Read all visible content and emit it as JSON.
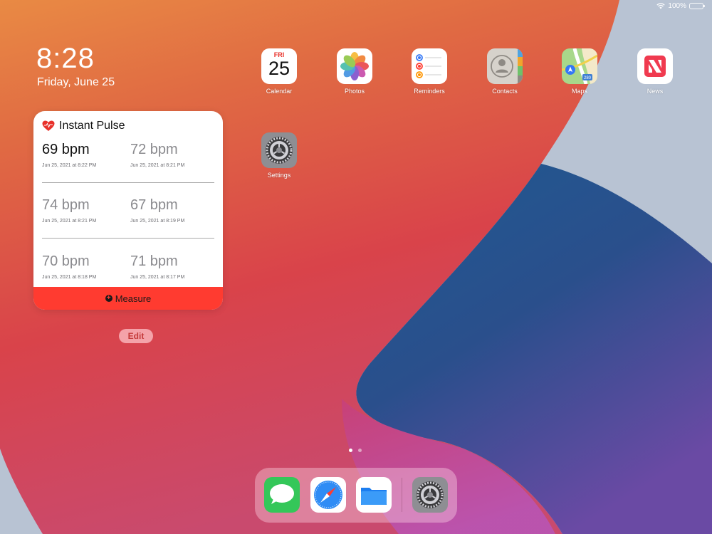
{
  "status": {
    "battery": "100%"
  },
  "lockscreen": {
    "time": "8:28",
    "date": "Friday, June 25"
  },
  "widget": {
    "title": "Instant Pulse",
    "readings": [
      {
        "bpm": "69 bpm",
        "time": "Jun 25, 2021 at 8:22 PM"
      },
      {
        "bpm": "72 bpm",
        "time": "Jun 25, 2021 at 8:21 PM"
      },
      {
        "bpm": "74 bpm",
        "time": "Jun 25, 2021 at 8:21 PM"
      },
      {
        "bpm": "67 bpm",
        "time": "Jun 25, 2021 at 8:19 PM"
      },
      {
        "bpm": "70 bpm",
        "time": "Jun 25, 2021 at 8:18 PM"
      },
      {
        "bpm": "71 bpm",
        "time": "Jun 25, 2021 at 8:17 PM"
      }
    ],
    "measure_label": "Measure",
    "accent": "#ff3b30"
  },
  "edit_label": "Edit",
  "calendar": {
    "day": "FRI",
    "date": "25"
  },
  "apps": [
    {
      "label": "Calendar",
      "icon": "calendar-icon"
    },
    {
      "label": "Photos",
      "icon": "photos-icon"
    },
    {
      "label": "Reminders",
      "icon": "reminders-icon"
    },
    {
      "label": "Contacts",
      "icon": "contacts-icon"
    },
    {
      "label": "Maps",
      "icon": "maps-icon"
    },
    {
      "label": "News",
      "icon": "news-icon"
    },
    {
      "label": "Settings",
      "icon": "settings-icon"
    }
  ],
  "maps": {
    "route": "280"
  },
  "dock": [
    "messages-icon",
    "safari-icon",
    "files-icon",
    "settings-icon"
  ]
}
